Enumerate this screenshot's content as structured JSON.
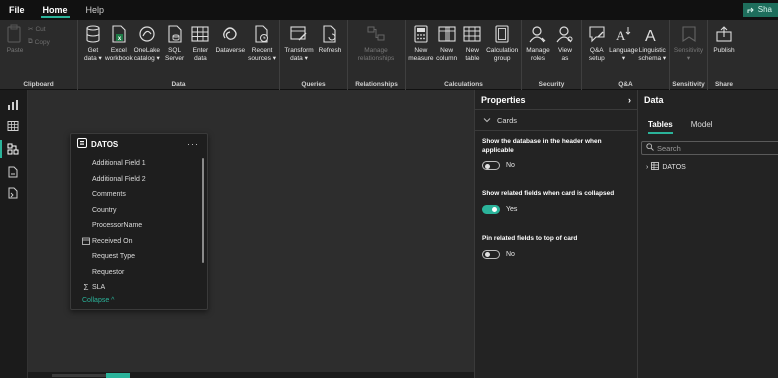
{
  "menu": {
    "items": [
      {
        "label": "File",
        "style": "plain-bold"
      },
      {
        "label": "Home",
        "style": "active"
      },
      {
        "label": "Help",
        "style": "plain"
      }
    ],
    "share_label": "Sha"
  },
  "ribbon": {
    "clipboard": {
      "label": "Clipboard",
      "paste": "Paste",
      "cut": "Cut",
      "copy": "Copy"
    },
    "data": {
      "label": "Data",
      "buttons": [
        {
          "line1": "Get",
          "line2": "data ▾"
        },
        {
          "line1": "Excel",
          "line2": "workbook"
        },
        {
          "line1": "OneLake",
          "line2": "catalog ▾"
        },
        {
          "line1": "SQL",
          "line2": "Server"
        },
        {
          "line1": "Enter",
          "line2": "data"
        },
        {
          "line1": "Dataverse",
          "line2": ""
        },
        {
          "line1": "Recent",
          "line2": "sources ▾"
        }
      ]
    },
    "queries": {
      "label": "Queries",
      "buttons": [
        {
          "line1": "Transform",
          "line2": "data ▾"
        },
        {
          "line1": "Refresh",
          "line2": ""
        }
      ]
    },
    "relationships": {
      "label": "Relationships",
      "buttons": [
        {
          "line1": "Manage",
          "line2": "relationships"
        }
      ]
    },
    "calculations": {
      "label": "Calculations",
      "buttons": [
        {
          "line1": "New",
          "line2": "measure"
        },
        {
          "line1": "New",
          "line2": "column"
        },
        {
          "line1": "New",
          "line2": "table"
        },
        {
          "line1": "Calculation",
          "line2": "group"
        }
      ]
    },
    "security": {
      "label": "Security",
      "buttons": [
        {
          "line1": "Manage",
          "line2": "roles"
        },
        {
          "line1": "View",
          "line2": "as"
        }
      ]
    },
    "qa": {
      "label": "Q&A",
      "buttons": [
        {
          "line1": "Q&A",
          "line2": "setup"
        },
        {
          "line1": "Language",
          "line2": "▾"
        },
        {
          "line1": "Linguistic",
          "line2": "schema ▾"
        }
      ]
    },
    "sensitivity": {
      "label": "Sensitivity",
      "buttons": [
        {
          "line1": "Sensitivity",
          "line2": "▾"
        }
      ]
    },
    "share": {
      "label": "Share",
      "buttons": [
        {
          "line1": "Publish",
          "line2": ""
        }
      ]
    }
  },
  "card": {
    "title": "DATOS",
    "more": "···",
    "fields": [
      {
        "label": "Additional Field 1",
        "icon": ""
      },
      {
        "label": "Additional Field 2",
        "icon": ""
      },
      {
        "label": "Comments",
        "icon": ""
      },
      {
        "label": "Country",
        "icon": ""
      },
      {
        "label": "ProcessorName",
        "icon": ""
      },
      {
        "label": "Received On",
        "icon": "calendar-icon"
      },
      {
        "label": "Request Type",
        "icon": ""
      },
      {
        "label": "Requestor",
        "icon": ""
      },
      {
        "label": "SLA",
        "icon": "sigma-icon"
      }
    ],
    "collapse_label": "Collapse ^"
  },
  "properties": {
    "title": "Properties",
    "collapse_chevron": "›",
    "section": "Cards",
    "options": [
      {
        "title": "Show the database in the header when applicable",
        "value": "No",
        "on": false
      },
      {
        "title": "Show related fields when card is collapsed",
        "value": "Yes",
        "on": true
      },
      {
        "title": "Pin related fields to top of card",
        "value": "No",
        "on": false
      }
    ]
  },
  "data_pane": {
    "title": "Data",
    "tabs": [
      "Tables",
      "Model"
    ],
    "active_tab": "Tables",
    "search_placeholder": "Search",
    "tree_item": "DATOS"
  },
  "colors": {
    "accent": "#2bb39a",
    "background": "#1f1f1f",
    "canvas": "#2d2d2d"
  }
}
